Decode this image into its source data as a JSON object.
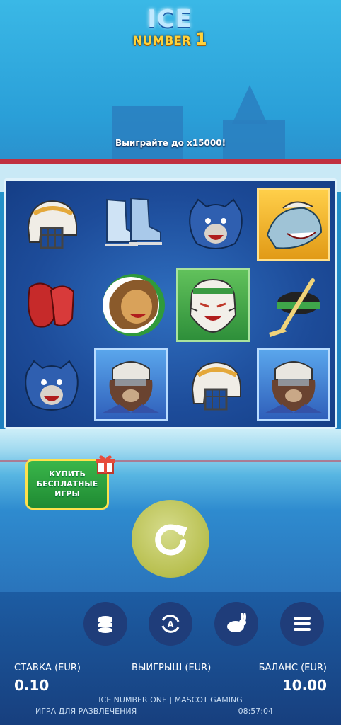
{
  "logo": {
    "line1": "ICE",
    "line2": "NUMBER",
    "line2_num": "1"
  },
  "promo_text": "Выиграйте до x15000!",
  "reels": [
    [
      "helmet-icon",
      "skates-icon",
      "bear-icon",
      "shark-icon"
    ],
    [
      "gloves-icon",
      "lion-icon",
      "tiger-icon",
      "puck-stick-icon"
    ],
    [
      "bear-icon",
      "brown-bear-icon",
      "helmet-icon",
      "brown-bear-icon"
    ]
  ],
  "buy_button": {
    "line1": "КУПИТЬ",
    "line2": "БЕСПЛАТНЫЕ ИГРЫ"
  },
  "controls": [
    "coins-icon",
    "autoplay-icon",
    "turbo-rabbit-icon",
    "menu-icon"
  ],
  "autoplay_letter": "A",
  "stake": {
    "label": "СТАВКА (EUR)",
    "value": "0.10"
  },
  "win": {
    "label": "ВЫИГРЫШ (EUR)"
  },
  "balance": {
    "label": "БАЛАНС (EUR)",
    "value": "10.00"
  },
  "footer": {
    "title": "ICE NUMBER ONE | MASCOT GAMING",
    "mode": "ИГРА ДЛЯ РАЗВЛЕЧЕНИЯ",
    "time": "08:57:04"
  }
}
